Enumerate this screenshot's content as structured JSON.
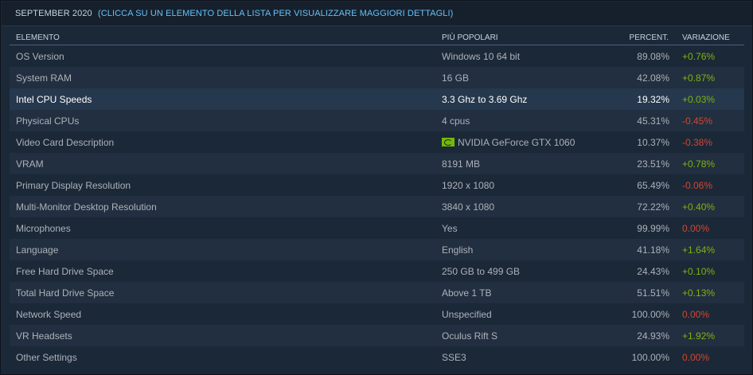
{
  "header": {
    "date": "SEPTEMBER 2020",
    "hint": "(CLICCA SU UN ELEMENTO DELLA LISTA PER VISUALIZZARE MAGGIORI DETTAGLI)"
  },
  "columns": {
    "name": "ELEMENTO",
    "value": "PIÙ POPOLARI",
    "percent": "PERCENT.",
    "change": "VARIAZIONE"
  },
  "rows": [
    {
      "name": "OS Version",
      "value": "Windows 10 64 bit",
      "percent": "89.08%",
      "change": "+0.76%",
      "trend": "pos"
    },
    {
      "name": "System RAM",
      "value": "16 GB",
      "percent": "42.08%",
      "change": "+0.87%",
      "trend": "pos"
    },
    {
      "name": "Intel CPU Speeds",
      "value": "3.3 Ghz to 3.69 Ghz",
      "percent": "19.32%",
      "change": "+0.03%",
      "trend": "pos"
    },
    {
      "name": "Physical CPUs",
      "value": "4 cpus",
      "percent": "45.31%",
      "change": "-0.45%",
      "trend": "neg"
    },
    {
      "name": "Video Card Description",
      "value": "NVIDIA GeForce GTX 1060",
      "percent": "10.37%",
      "change": "-0.38%",
      "trend": "neg",
      "icon": "nvidia-logo-icon"
    },
    {
      "name": "VRAM",
      "value": "8191 MB",
      "percent": "23.51%",
      "change": "+0.78%",
      "trend": "pos"
    },
    {
      "name": "Primary Display Resolution",
      "value": "1920 x 1080",
      "percent": "65.49%",
      "change": "-0.06%",
      "trend": "neg"
    },
    {
      "name": "Multi-Monitor Desktop Resolution",
      "value": "3840 x 1080",
      "percent": "72.22%",
      "change": "+0.40%",
      "trend": "pos"
    },
    {
      "name": "Microphones",
      "value": "Yes",
      "percent": "99.99%",
      "change": "0.00%",
      "trend": "zero"
    },
    {
      "name": "Language",
      "value": "English",
      "percent": "41.18%",
      "change": "+1.64%",
      "trend": "pos"
    },
    {
      "name": "Free Hard Drive Space",
      "value": "250 GB to 499 GB",
      "percent": "24.43%",
      "change": "+0.10%",
      "trend": "pos"
    },
    {
      "name": "Total Hard Drive Space",
      "value": "Above 1 TB",
      "percent": "51.51%",
      "change": "+0.13%",
      "trend": "pos"
    },
    {
      "name": "Network Speed",
      "value": "Unspecified",
      "percent": "100.00%",
      "change": "0.00%",
      "trend": "zero"
    },
    {
      "name": "VR Headsets",
      "value": "Oculus Rift S",
      "percent": "24.93%",
      "change": "+1.92%",
      "trend": "pos"
    },
    {
      "name": "Other Settings",
      "value": "SSE3",
      "percent": "100.00%",
      "change": "0.00%",
      "trend": "zero"
    }
  ],
  "selected_row": "Intel CPU Speeds",
  "colors": {
    "background": "#1b2838",
    "positive": "#7eb30e",
    "negative": "#d4452f",
    "link": "#66c0f4"
  }
}
